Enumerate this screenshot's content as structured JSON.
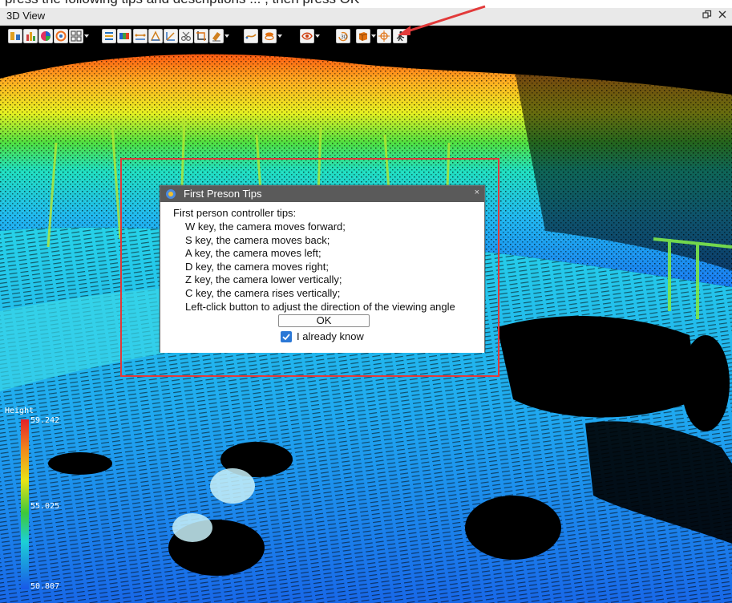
{
  "caption_strip": {
    "cut_text": "press the following tips and descriptions ... , then press OK"
  },
  "window": {
    "title": "3D View",
    "float_icon": "restore-icon",
    "close_icon": "close-icon"
  },
  "toolbar": {
    "tools": [
      {
        "name": "color-by-height-icon",
        "color": "#e0a020"
      },
      {
        "name": "classify-icon",
        "color": "#d04040"
      },
      {
        "name": "color-by-rgb-icon",
        "color": "#e23060"
      },
      {
        "name": "color-by-intensity-icon",
        "color": "#f07020"
      },
      {
        "name": "grid-display-icon",
        "color": "#e0a020"
      },
      {
        "name": "filter-icon",
        "color": "#2070c0"
      },
      {
        "name": "color-bar-icon",
        "color": "#40a040"
      },
      {
        "name": "measure-distance-icon",
        "color": "#d08020"
      },
      {
        "name": "measure-height-icon",
        "color": "#d08020"
      },
      {
        "name": "measure-slope-icon",
        "color": "#d08020"
      },
      {
        "name": "scissor-icon",
        "color": "#606060"
      },
      {
        "name": "crop-icon",
        "color": "#e07010"
      },
      {
        "name": "eraser-icon",
        "color": "#d08020"
      },
      {
        "name": "roaming-icon",
        "color": "#d08020"
      },
      {
        "name": "layer-stack-icon",
        "color": "#e07010"
      },
      {
        "name": "eye-visibility-icon",
        "color": "#d04010"
      },
      {
        "name": "rotate-3d-icon",
        "color": "#e08020"
      },
      {
        "name": "view-cube-icon",
        "color": "#e07010"
      },
      {
        "name": "center-target-icon",
        "color": "#e07010"
      },
      {
        "name": "first-person-walk-icon",
        "color": "#303030"
      }
    ]
  },
  "dialog": {
    "title": "First Preson Tips",
    "close_glyph": "×",
    "heading": "First person controller tips:",
    "tips": [
      "W key, the camera moves forward;",
      "S key, the camera moves back;",
      "A key, the camera moves left;",
      "D key, the camera moves right;",
      "Z key, the camera lower vertically;",
      "C key, the camera rises vertically;",
      "Left-click button to adjust the direction of the viewing angle"
    ],
    "ok_label": "OK",
    "checkbox_label": "I already know",
    "checkbox_checked": true
  },
  "legend": {
    "title": "Height",
    "max": "59.242",
    "mid": "55.025",
    "min": "50.807",
    "colors": [
      "#e4202a",
      "#f08a1c",
      "#e8e417",
      "#3ec83a",
      "#1cd0d6",
      "#1858e8"
    ]
  },
  "accent": {
    "annotation_red": "#e23a3a",
    "checkbox_blue": "#2b78d6"
  }
}
